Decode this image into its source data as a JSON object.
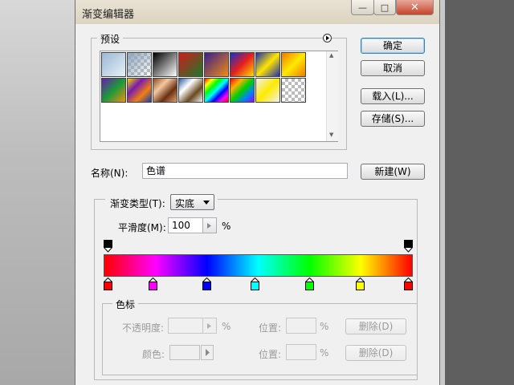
{
  "window": {
    "title": "渐变编辑器",
    "minimize_glyph": "—",
    "maximize_glyph": "□",
    "close_glyph": "✕"
  },
  "presets": {
    "legend": "预设",
    "menu_icon": "play-circle-icon",
    "scroll_up_glyph": "▲",
    "scroll_down_glyph": "▼",
    "swatches": [
      {
        "name": "foreground-to-background",
        "colors": [
          "#9ab9d4",
          "#e5f0f8"
        ]
      },
      {
        "name": "foreground-to-transparent",
        "colors": [
          "#8fa7bd",
          "transparent"
        ]
      },
      {
        "name": "black-white",
        "colors": [
          "#000000",
          "#ffffff"
        ]
      },
      {
        "name": "red-green",
        "colors": [
          "#d01c1c",
          "#1a7a2a"
        ]
      },
      {
        "name": "violet-orange",
        "colors": [
          "#3a1f8c",
          "#f08a14"
        ]
      },
      {
        "name": "blue-red-yellow",
        "colors": [
          "#1432c8",
          "#e61e1e",
          "#ffdd00"
        ]
      },
      {
        "name": "blue-yellow-blue",
        "colors": [
          "#1a2fb4",
          "#ffe400",
          "#1a2fb4"
        ]
      },
      {
        "name": "orange-yellow-orange",
        "colors": [
          "#f07800",
          "#ffea00",
          "#f07800"
        ]
      },
      {
        "name": "violet-green-orange",
        "colors": [
          "#6a1cb0",
          "#1a9a3a",
          "#f09010"
        ]
      },
      {
        "name": "yellow-violet-orange-blue",
        "colors": [
          "#f0d800",
          "#7a1ab0",
          "#f08010",
          "#1a3ab0"
        ]
      },
      {
        "name": "copper",
        "colors": [
          "#8a4a20",
          "#f4c8a0",
          "#6a3010",
          "#e0a070"
        ]
      },
      {
        "name": "chrome",
        "colors": [
          "#2a5aa0",
          "#ffffff",
          "#6a4a20",
          "#f0f0f0"
        ]
      },
      {
        "name": "spectrum",
        "colors": [
          "#ff0000",
          "#ffff00",
          "#00ff00",
          "#00ffff",
          "#0000ff",
          "#ff00ff",
          "#ff0000"
        ]
      },
      {
        "name": "transparent-rainbow",
        "colors": [
          "#ff0000",
          "#ffb000",
          "#00d000",
          "#0080ff",
          "#a000ff"
        ]
      },
      {
        "name": "transparent-stripes",
        "colors": [
          "#f0f0f0",
          "#ffea00",
          "#f0f0f0"
        ]
      },
      {
        "name": "transparent-checker",
        "colors": [
          "transparent",
          "transparent"
        ]
      }
    ]
  },
  "buttons": {
    "ok": "确定",
    "cancel": "取消",
    "load": "载入(L)...",
    "save": "存储(S)...",
    "new": "新建(W)"
  },
  "name": {
    "label": "名称(N):",
    "value": "色谱"
  },
  "gradient": {
    "type_label": "渐变类型(T):",
    "type_value": "实底",
    "smoothness_label": "平滑度(M):",
    "smoothness_value": "100",
    "smoothness_unit": "%",
    "bar_colors": [
      "#ff0000",
      "#ff00ff",
      "#0000ff",
      "#00ffff",
      "#00ff00",
      "#ffff00",
      "#ff0000"
    ],
    "opacity_stops": [
      0,
      100
    ],
    "color_stops": [
      {
        "position": 0,
        "color": "#ff0000"
      },
      {
        "position": 15,
        "color": "#ff00ff"
      },
      {
        "position": 33,
        "color": "#0000ff"
      },
      {
        "position": 49,
        "color": "#00ffff"
      },
      {
        "position": 67,
        "color": "#00ff00"
      },
      {
        "position": 84,
        "color": "#ffff00"
      },
      {
        "position": 100,
        "color": "#ff0000"
      }
    ]
  },
  "color_stops_group": {
    "legend": "色标",
    "opacity_label": "不透明度:",
    "opacity_unit": "%",
    "location_label_1": "位置:",
    "location_unit_1": "%",
    "delete_1": "删除(D)",
    "color_label": "颜色:",
    "location_label_2": "位置:",
    "location_unit_2": "%",
    "delete_2": "删除(D)"
  }
}
